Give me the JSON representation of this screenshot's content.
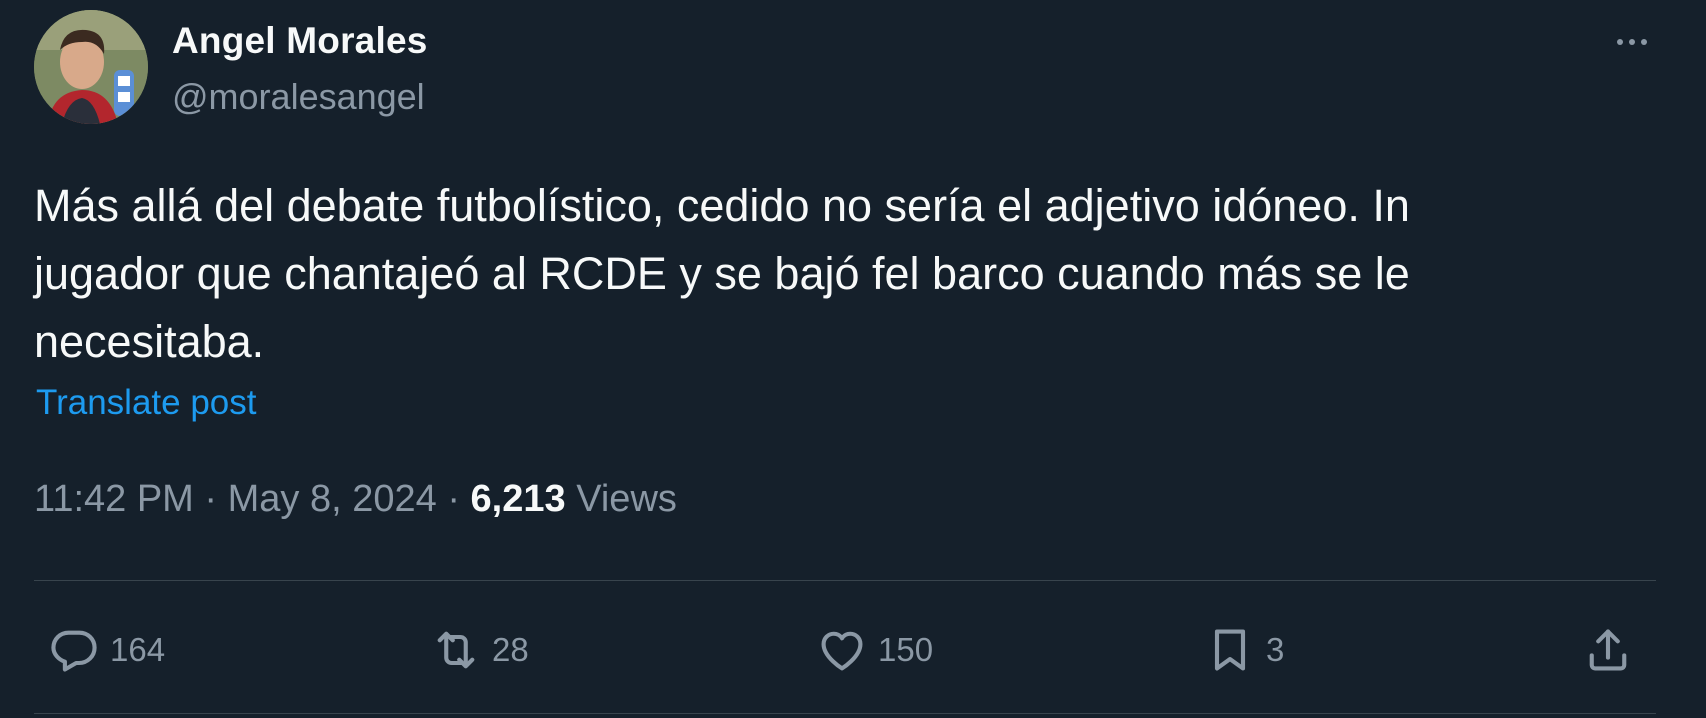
{
  "author": {
    "display_name": "Angel Morales",
    "handle": "@moralesangel"
  },
  "post": {
    "text_lines": [
      "Más allá del debate futbolístico, cedido no sería el adjetivo idóneo. In",
      "jugador que chantajeó al RCDE y se bajó fel barco cuando más se le",
      "necesitaba."
    ],
    "translate_label": "Translate post",
    "time": "11:42 PM",
    "date": "May 8, 2024",
    "separator": " · ",
    "views_count": "6,213",
    "views_label": "Views"
  },
  "actions": {
    "reply_count": "164",
    "repost_count": "28",
    "like_count": "150",
    "bookmark_count": "3"
  },
  "icons": {
    "more": "more-horizontal-icon",
    "reply": "reply-icon",
    "repost": "repost-icon",
    "like": "heart-icon",
    "bookmark": "bookmark-icon",
    "share": "share-icon"
  },
  "colors": {
    "background": "#15202b",
    "primary_text": "#f7f9f9",
    "secondary_text": "#8b98a5",
    "link": "#1d9bf0",
    "divider": "#38444d"
  }
}
